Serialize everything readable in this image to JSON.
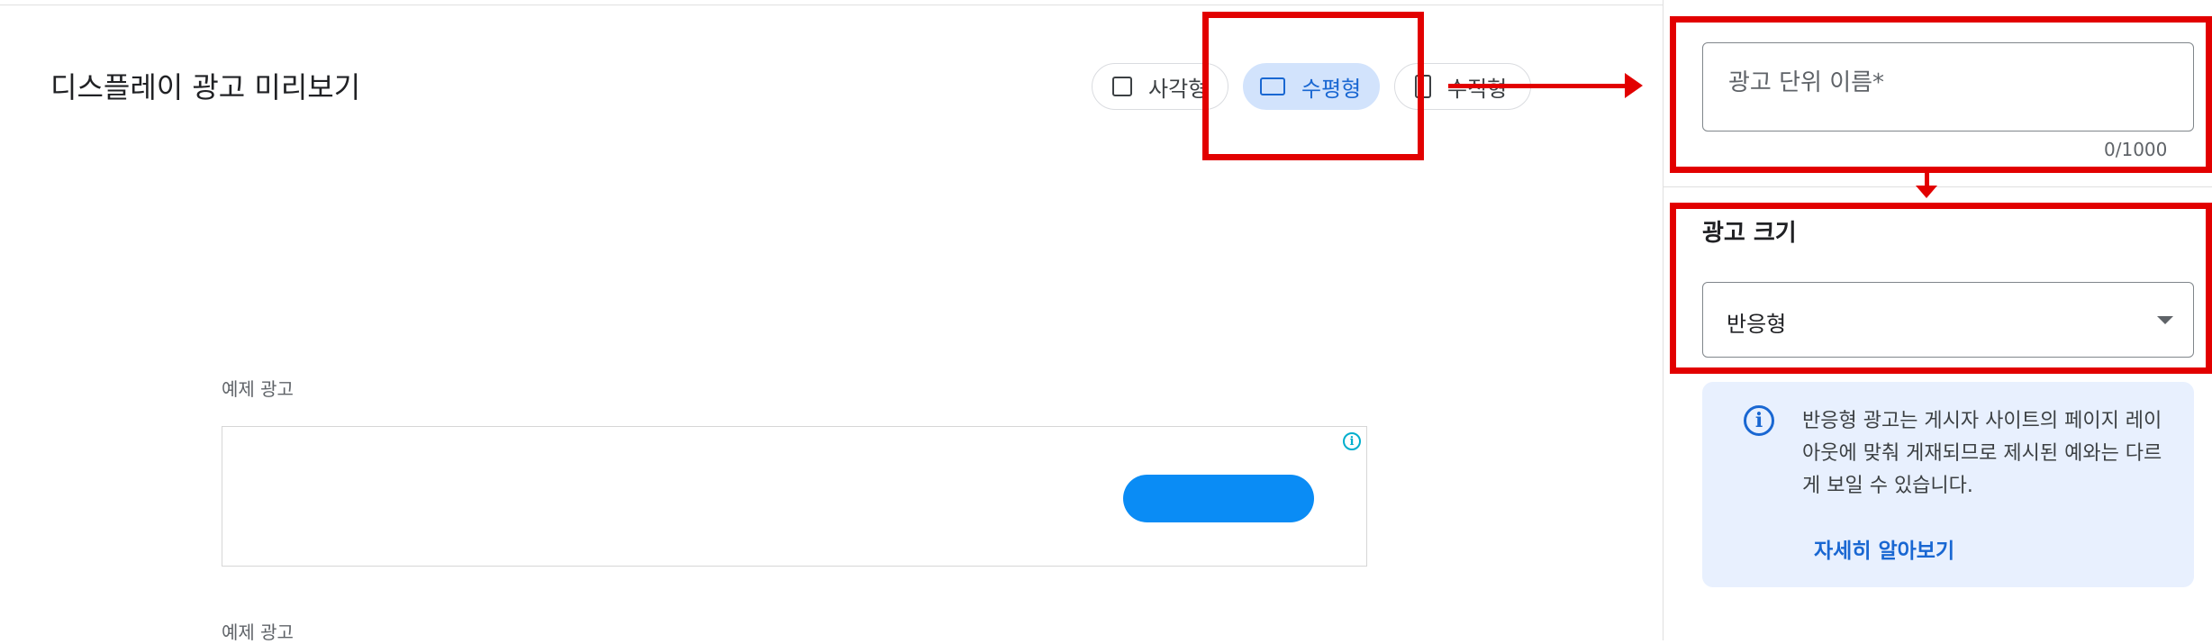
{
  "preview": {
    "title": "디스플레이 광고 미리보기",
    "format_toggle": {
      "square_label": "사각형",
      "horizontal_label": "수평형",
      "vertical_label": "수직형",
      "selected": "수평형"
    },
    "sample_label": "예제 광고",
    "sample_label_2": "예제 광고"
  },
  "settings": {
    "ad_unit_name": {
      "placeholder": "광고 단위 이름*",
      "value": "",
      "char_count": "0/1000"
    },
    "ad_size": {
      "heading": "광고 크기",
      "selected": "반응형"
    },
    "info": {
      "text": "반응형 광고는 게시자 사이트의 페이지 레이아웃에 맞춰 게재되므로 제시된 예와는 다르게 보일 수 있습니다.",
      "link": "자세히 알아보기"
    }
  },
  "icons": {
    "info": "info-icon",
    "ad_choices": "ad-info-icon",
    "dropdown": "dropdown-arrow-icon"
  },
  "colors": {
    "accent": "#1967d2",
    "selected_chip_bg": "#d2e3fc",
    "annotation": "#e20000",
    "ad_button": "#0a8cf5"
  }
}
